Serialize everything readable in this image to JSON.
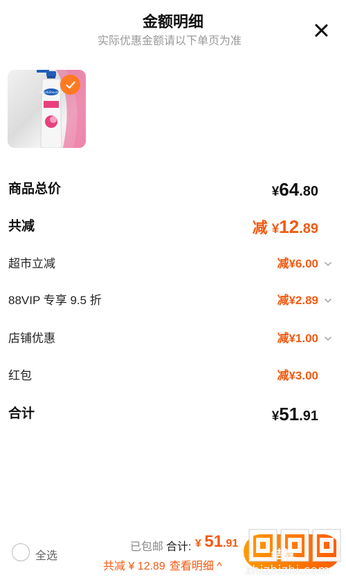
{
  "header": {
    "title": "金额明细",
    "subtitle": "实际优惠金额请以下单页为准"
  },
  "product": {
    "image_desc": "shampoo-bottle",
    "selected": true
  },
  "rows": {
    "total_price": {
      "label": "商品总价",
      "currency": "¥",
      "int": "64",
      "dec": ".80"
    },
    "total_reduce": {
      "label": "共减",
      "prefix": "减",
      "currency": "¥",
      "int": "12",
      "dec": ".89"
    },
    "supermarket": {
      "label": "超市立减",
      "value": "减¥6.00"
    },
    "vip": {
      "label": "88VIP 专享 9.5 折",
      "value": "减¥2.89"
    },
    "shop": {
      "label": "店铺优惠",
      "value": "减¥1.00"
    },
    "red_packet": {
      "label": "红包",
      "value": "减¥3.00"
    },
    "sum": {
      "label": "合计",
      "currency": "¥",
      "int": "51",
      "dec": ".91"
    }
  },
  "bottom_bar": {
    "select_all": "全选",
    "shipping": "已包邮",
    "total_label": "合计:",
    "total_currency": "¥ ",
    "total_int": "51",
    "total_dec": ".91",
    "saved_label": "共减 ¥ 12.89",
    "detail_link": "查看明细 ^",
    "checkout_label": "结算"
  },
  "watermark": {
    "text": "zhizhizhi.com"
  },
  "colors": {
    "accent": "#f25a12",
    "checkout_start": "#ff9a00",
    "checkout_end": "#ff5a00",
    "badge": "#ff7a21"
  }
}
